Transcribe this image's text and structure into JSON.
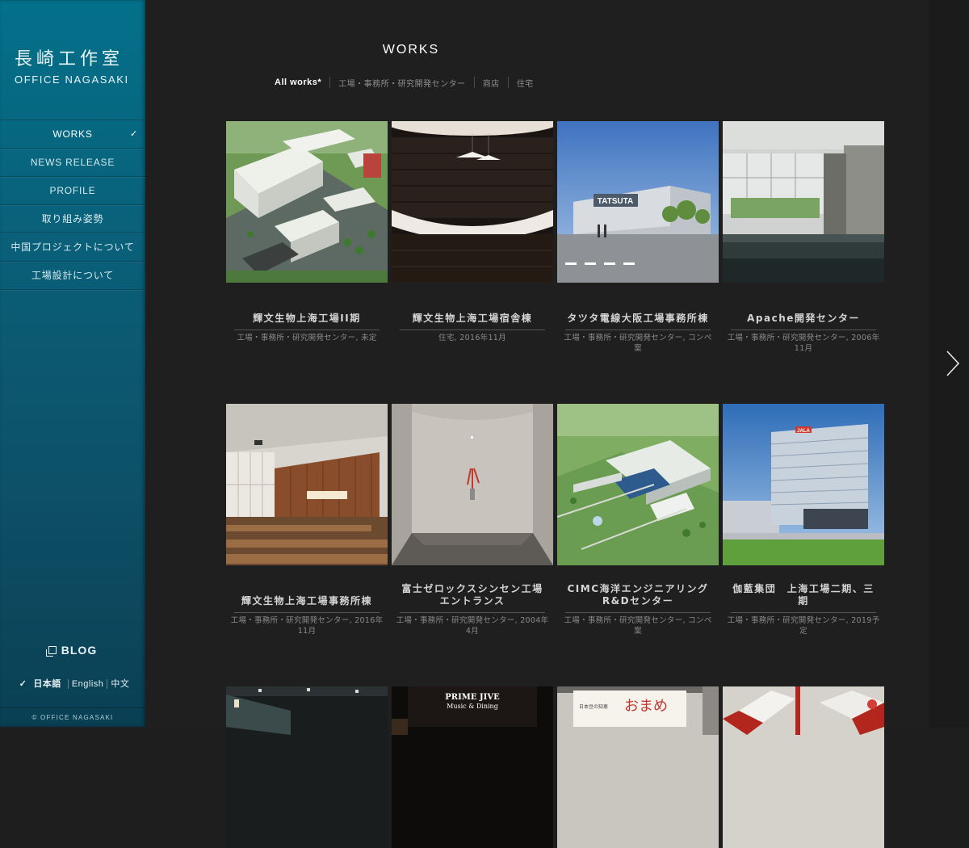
{
  "brand": {
    "name_jp": "長崎工作室",
    "name_en": "OFFICE NAGASAKI"
  },
  "nav": [
    {
      "label": "WORKS",
      "active": true
    },
    {
      "label": "NEWS RELEASE"
    },
    {
      "label": "PROFILE"
    },
    {
      "label": "取り組み姿勢"
    },
    {
      "label": "中国プロジェクトについて"
    },
    {
      "label": "工場設計について"
    }
  ],
  "nav_active_mark": "✓",
  "blog_label": "BLOG",
  "languages": {
    "check": "✓",
    "ja": "日本語",
    "en": "English",
    "zh": "中文"
  },
  "copyright": "© OFFICE NAGASAKI",
  "page_title": "WORKS",
  "filters": {
    "all": "All works*",
    "factory": "工場・事務所・研究開発センター",
    "shop": "商店",
    "house": "住宅"
  },
  "works": [
    {
      "title": "輝文生物上海工場II期",
      "meta": "工場・事務所・研究開発センター, 未定"
    },
    {
      "title": "輝文生物上海工場宿舎棟",
      "meta": "住宅, 2016年11月"
    },
    {
      "title": "タツタ電線大阪工場事務所棟",
      "meta": "工場・事務所・研究開発センター, コンペ案"
    },
    {
      "title": "Apache開発センター",
      "meta": "工場・事務所・研究開発センター, 2006年11月"
    },
    {
      "title": "輝文生物上海工場事務所棟",
      "meta": "工場・事務所・研究開発センター, 2016年11月"
    },
    {
      "title": "富士ゼロックスシンセン工場　エントランス",
      "meta": "工場・事務所・研究開発センター, 2004年4月"
    },
    {
      "title": "CIMC海洋エンジニアリング R&Dセンター",
      "meta": "工場・事務所・研究開発センター, コンペ案"
    },
    {
      "title": "伽藍集団　上海工場二期、三期",
      "meta": "工場・事務所・研究開発センター, 2019予定"
    }
  ],
  "thumb_texts": {
    "tatsuta_sign": "TATSUTA",
    "jala_sign": "JALA",
    "prime_jive_1": "PRIME JIVE",
    "prime_jive_2": "Music & Dining",
    "omame_small": "日本豆の知恵",
    "omame_big": "おまめ"
  }
}
